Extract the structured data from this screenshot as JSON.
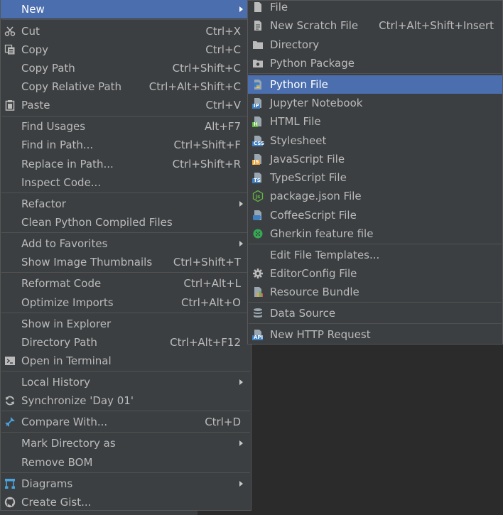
{
  "context_menu": {
    "new_label": "New",
    "cut": {
      "label": "Cut",
      "shortcut": "Ctrl+X"
    },
    "copy": {
      "label": "Copy",
      "shortcut": "Ctrl+C"
    },
    "copy_path": {
      "label": "Copy Path",
      "shortcut": "Ctrl+Shift+C"
    },
    "copy_relative_path": {
      "label": "Copy Relative Path",
      "shortcut": "Ctrl+Alt+Shift+C"
    },
    "paste": {
      "label": "Paste",
      "shortcut": "Ctrl+V"
    },
    "find_usages": {
      "label": "Find Usages",
      "shortcut": "Alt+F7"
    },
    "find_in_path": {
      "label": "Find in Path...",
      "shortcut": "Ctrl+Shift+F"
    },
    "replace_in_path": {
      "label": "Replace in Path...",
      "shortcut": "Ctrl+Shift+R"
    },
    "inspect_code": {
      "label": "Inspect Code..."
    },
    "refactor": {
      "label": "Refactor"
    },
    "clean_python": {
      "label": "Clean Python Compiled Files"
    },
    "add_to_favorites": {
      "label": "Add to Favorites"
    },
    "show_image_thumbnails": {
      "label": "Show Image Thumbnails",
      "shortcut": "Ctrl+Shift+T"
    },
    "reformat_code": {
      "label": "Reformat Code",
      "shortcut": "Ctrl+Alt+L"
    },
    "optimize_imports": {
      "label": "Optimize Imports",
      "shortcut": "Ctrl+Alt+O"
    },
    "show_in_explorer": {
      "label": "Show in Explorer"
    },
    "directory_path": {
      "label": "Directory Path",
      "shortcut": "Ctrl+Alt+F12"
    },
    "open_in_terminal": {
      "label": "Open in Terminal"
    },
    "local_history": {
      "label": "Local History"
    },
    "synchronize": {
      "label": "Synchronize 'Day 01'"
    },
    "compare_with": {
      "label": "Compare With...",
      "shortcut": "Ctrl+D"
    },
    "mark_directory_as": {
      "label": "Mark Directory as"
    },
    "remove_bom": {
      "label": "Remove BOM"
    },
    "diagrams": {
      "label": "Diagrams"
    },
    "create_gist": {
      "label": "Create Gist..."
    }
  },
  "new_submenu": {
    "file": {
      "label": "File"
    },
    "new_scratch_file": {
      "label": "New Scratch File",
      "shortcut": "Ctrl+Alt+Shift+Insert"
    },
    "directory": {
      "label": "Directory"
    },
    "python_package": {
      "label": "Python Package"
    },
    "python_file": {
      "label": "Python File"
    },
    "jupyter_notebook": {
      "label": "Jupyter Notebook",
      "badge": "IP"
    },
    "html_file": {
      "label": "HTML File",
      "badge": "H"
    },
    "stylesheet": {
      "label": "Stylesheet",
      "badge": "CSS"
    },
    "javascript_file": {
      "label": "JavaScript File",
      "badge": "JS"
    },
    "typescript_file": {
      "label": "TypeScript File",
      "badge": "TS"
    },
    "package_json_file": {
      "label": "package.json File"
    },
    "coffeescript_file": {
      "label": "CoffeeScript File"
    },
    "gherkin_feature_file": {
      "label": "Gherkin feature file"
    },
    "edit_file_templates": {
      "label": "Edit File Templates..."
    },
    "editorconfig_file": {
      "label": "EditorConfig File"
    },
    "resource_bundle": {
      "label": "Resource Bundle"
    },
    "data_source": {
      "label": "Data Source"
    },
    "new_http_request": {
      "label": "New HTTP Request",
      "badge": "API"
    }
  },
  "colors": {
    "menu_bg": "#3c3f41",
    "selection": "#4b6eaf",
    "text": "#bbbbbb",
    "separator": "#515151"
  }
}
